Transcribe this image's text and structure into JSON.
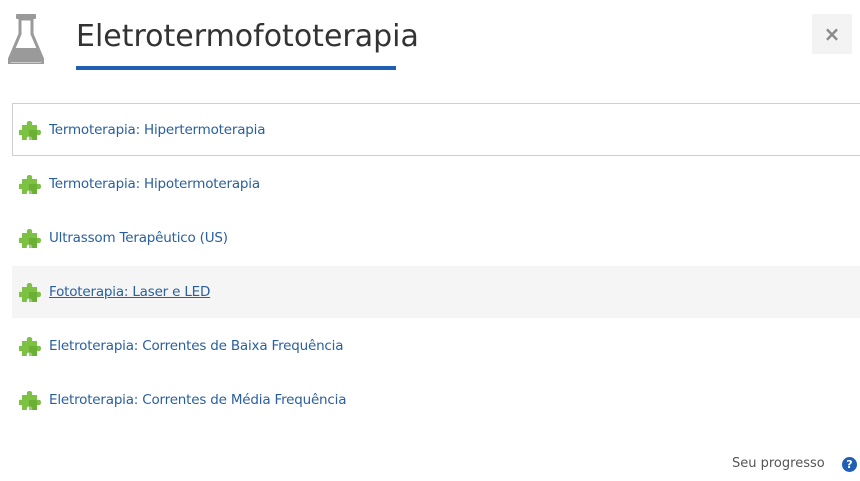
{
  "header": {
    "title": "Eletrotermofototerapia",
    "icon": "flask-icon",
    "close_icon": "close-icon",
    "close_label": "×",
    "accent_color": "#1f5fb4"
  },
  "items": [
    {
      "label": "Termoterapia: Hipertermoterapia",
      "icon": "puzzle-icon",
      "state": "selected"
    },
    {
      "label": "Termoterapia: Hipotermoterapia",
      "icon": "puzzle-icon",
      "state": "normal"
    },
    {
      "label": "Ultrassom Terapêutico (US)",
      "icon": "puzzle-icon",
      "state": "normal"
    },
    {
      "label": "Fototerapia: Laser e LED",
      "icon": "puzzle-icon",
      "state": "hover"
    },
    {
      "label": "Eletroterapia: Correntes de Baixa Frequência",
      "icon": "puzzle-icon",
      "state": "normal"
    },
    {
      "label": "Eletroterapia: Correntes de Média Frequência",
      "icon": "puzzle-icon",
      "state": "normal"
    }
  ],
  "footer": {
    "progress_label": "Seu progresso",
    "help_icon": "help-icon",
    "help_glyph": "?"
  }
}
